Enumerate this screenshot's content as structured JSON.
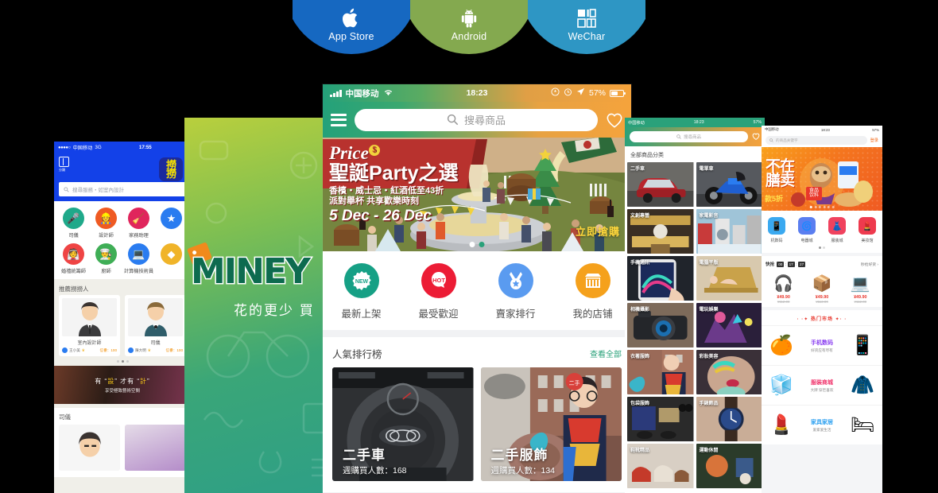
{
  "download_tabs": [
    {
      "label": "App Store",
      "icon": "apple-icon",
      "color": "#1668c1"
    },
    {
      "label": "Android",
      "icon": "android-icon",
      "color": "#84a94f"
    },
    {
      "label": "WeChar",
      "icon": "qrcode-icon",
      "color": "#2e96c4"
    }
  ],
  "left_phone": {
    "status": {
      "dots": "●●●●○",
      "carrier": "中国移动",
      "network": "3G",
      "time": "17:55"
    },
    "menu_label": "分類",
    "logo_text_top": "撈",
    "logo_text_bottom": "撈",
    "search_placeholder": "搜尋服務・如室內設計",
    "categories": [
      {
        "label": "司儀",
        "icon": "microphone-icon",
        "color": "#1fa98a"
      },
      {
        "label": "設計師",
        "icon": "designer-icon",
        "color": "#ef5a22"
      },
      {
        "label": "家務助理",
        "icon": "broom-icon",
        "color": "#e0255c"
      },
      {
        "label": "婚禮統籌師",
        "icon": "wedding-icon",
        "color": "#ef4444"
      },
      {
        "label": "廚師",
        "icon": "chef-icon",
        "color": "#3fae56"
      },
      {
        "label": "計算機技術員",
        "icon": "computer-icon",
        "color": "#2a7cf0"
      }
    ],
    "recommend_title": "推薦撈撈人",
    "recommend_cards": [
      {
        "role": "室內設計師",
        "name": "王小美",
        "score_label": "信譽：",
        "score": "100"
      },
      {
        "role": "司儀",
        "name": "陳大明",
        "score_label": "信譽：",
        "score": "100"
      }
    ],
    "banner_line1_pre": "有 “",
    "banner_line1_em": "設",
    "banner_line1_mid": "” 才有 “",
    "banner_line1_em2": "計",
    "banner_line1_post": "”",
    "banner_line2": "享受極致藝術空間",
    "section2_title": "司儀"
  },
  "splash_phone": {
    "logo": "MINEY",
    "tagline": "花的更少  買"
  },
  "main_phone": {
    "status": {
      "carrier": "中国移动",
      "time": "18:23",
      "battery": "57%"
    },
    "search_placeholder": "搜尋商品",
    "banner": {
      "brand": "Price",
      "headline": "聖誕Party之選",
      "sub1": "香檳・威士忌・紅酒低至43折",
      "sub2": "派對舉杯  共享歡樂時刻",
      "dates": "5 Dec - 26 Dec",
      "cta": "立即搶購"
    },
    "nav": [
      {
        "label": "最新上架",
        "badge": "NEW",
        "icon": "new-badge-icon",
        "color": "#16a085"
      },
      {
        "label": "最受歡迎",
        "badge": "HOT",
        "icon": "hot-badge-icon",
        "color": "#ec1c35"
      },
      {
        "label": "賣家排行",
        "badge": "",
        "icon": "medal-icon",
        "color": "#5a9bf0"
      },
      {
        "label": "我的店铺",
        "badge": "",
        "icon": "shop-icon",
        "color": "#f5a11c"
      }
    ],
    "ranking": {
      "title": "人氣排行榜",
      "view_all": "查看全部",
      "cards": [
        {
          "title": "二手車",
          "sub": "週購買人數：168"
        },
        {
          "title": "二手服飾",
          "sub": "週購買人數：134"
        }
      ]
    }
  },
  "category_phone": {
    "status": {
      "carrier": "中国移动",
      "time": "18:23",
      "battery": "57%"
    },
    "search_placeholder": "搜尋商品",
    "title": "全部商品分类",
    "cells": [
      {
        "label": "二手車",
        "art": "car"
      },
      {
        "label": "電單車",
        "art": "motorbike"
      },
      {
        "label": "文創專營",
        "art": "craft"
      },
      {
        "label": "家電影音",
        "art": "appliance"
      },
      {
        "label": "手機通訊",
        "art": "phone"
      },
      {
        "label": "電腦平版",
        "art": "laptop"
      },
      {
        "label": "相機攝影",
        "art": "camera"
      },
      {
        "label": "電玩娛樂",
        "art": "game"
      },
      {
        "label": "衣著服飾",
        "art": "fashion"
      },
      {
        "label": "彩妝美容",
        "art": "beauty"
      },
      {
        "label": "包袋服飾",
        "art": "bag"
      },
      {
        "label": "手錶飾品",
        "art": "watch"
      },
      {
        "label": "鞋靴精品",
        "art": "shoes"
      },
      {
        "label": "運動休閒",
        "art": "sport"
      }
    ]
  },
  "right_phone": {
    "status": {
      "carrier": "中国移动",
      "time": "18:23",
      "battery": "57%"
    },
    "search_placeholder": "的商品关键字",
    "login": "登录",
    "hero": {
      "line1": "不在",
      "line2": "膳卖",
      "discount": "款5折",
      "tag_line1": "食品",
      "tag_line2": "饮料"
    },
    "quick": [
      {
        "label": "机数码",
        "icon": "mobile-icon",
        "color": "#3aa9f0"
      },
      {
        "label": "电器城",
        "icon": "washer-icon",
        "color": "#5a7ef0"
      },
      {
        "label": "服装城",
        "icon": "dress-icon",
        "color": "#f0425e"
      },
      {
        "label": "美妆馆",
        "icon": "cosmetics-icon",
        "color": "#ee3a4e"
      }
    ],
    "flash": {
      "title": "快抢",
      "countdown": [
        "00",
        "17",
        "27"
      ],
      "more": "秒抢好货 ›",
      "products": [
        {
          "icon": "earphone-icon",
          "price": "¥49.90",
          "orig": "¥112.00"
        },
        {
          "icon": "box-icon",
          "price": "¥49.90",
          "orig": "¥112.00"
        },
        {
          "icon": "laptop-icon",
          "price": "¥49.90",
          "orig": "¥112.00"
        }
      ]
    },
    "hot_title": "· ·✦ 热门市场 ✦· ·",
    "markets": [
      {
        "title": "手机数码",
        "sub": "好货应有尽有",
        "color": "#8a3ff0",
        "left_icon": "orange-icon",
        "right_icon": "phone-icon"
      },
      {
        "title": "服装商城",
        "sub": "大牌 穿巨喜欢",
        "color": "#f0336b",
        "left_icon": "fridge-icon",
        "right_icon": "jacket-icon"
      },
      {
        "title": "家具家居",
        "sub": "爱家爱生活",
        "color": "#2a9ff0",
        "left_icon": "lipstick-icon",
        "right_icon": "bedding-icon"
      }
    ]
  }
}
